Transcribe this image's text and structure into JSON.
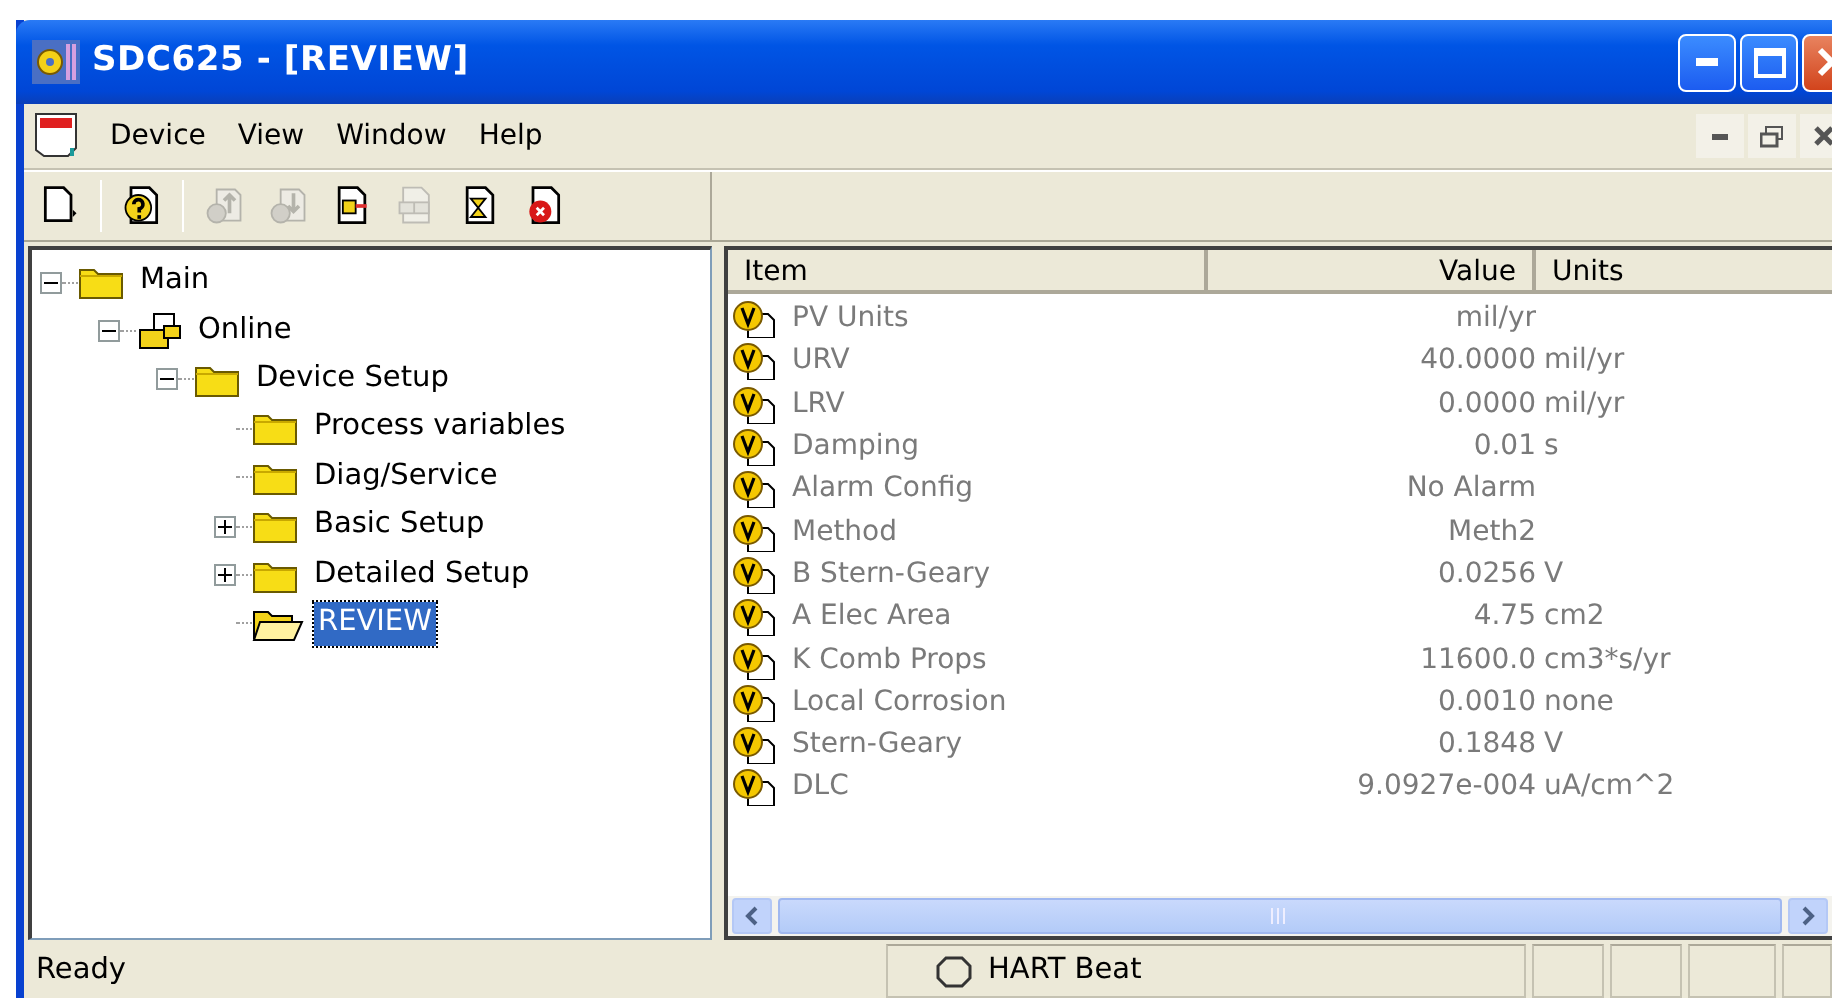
{
  "window": {
    "title": "SDC625 - [REVIEW]"
  },
  "menu": [
    "Device",
    "View",
    "Window",
    "Help"
  ],
  "toolbar": [
    {
      "kind": "new",
      "disabled": false
    },
    {
      "kind": "help",
      "disabled": false
    },
    {
      "kind": "upload",
      "disabled": true
    },
    {
      "kind": "download",
      "disabled": true
    },
    {
      "kind": "export",
      "disabled": false
    },
    {
      "kind": "grid",
      "disabled": true
    },
    {
      "kind": "wait",
      "disabled": false
    },
    {
      "kind": "stop",
      "disabled": false
    }
  ],
  "tree": [
    {
      "label": "Main",
      "kind": "folder",
      "expanded": true,
      "selected": false,
      "children": [
        {
          "label": "Online",
          "kind": "network",
          "expanded": true,
          "selected": false,
          "children": [
            {
              "label": "Device Setup",
              "kind": "folder",
              "expanded": true,
              "selected": false,
              "children": [
                {
                  "label": "Process variables",
                  "kind": "folder",
                  "selected": false
                },
                {
                  "label": "Diag/Service",
                  "kind": "folder",
                  "selected": false
                },
                {
                  "label": "Basic Setup",
                  "kind": "folder",
                  "expanded": false,
                  "selected": false
                },
                {
                  "label": "Detailed Setup",
                  "kind": "folder",
                  "expanded": false,
                  "selected": false
                },
                {
                  "label": "REVIEW",
                  "kind": "folder",
                  "selected": true
                }
              ]
            }
          ]
        }
      ]
    }
  ],
  "table": {
    "columns": [
      "Item",
      "Value",
      "Units"
    ],
    "rows": [
      {
        "item": "PV Units",
        "value": "mil/yr"
      },
      {
        "item": "URV",
        "value": "40.0000",
        "units": "mil/yr"
      },
      {
        "item": "LRV",
        "value": "0.0000",
        "units": "mil/yr"
      },
      {
        "item": "Damping",
        "value": "0.01",
        "units": "s"
      },
      {
        "item": "Alarm Config",
        "value": "No Alarm"
      },
      {
        "item": "Method",
        "value": "Meth2"
      },
      {
        "item": "B Stern-Geary",
        "value": "0.0256",
        "units": "V"
      },
      {
        "item": "A Elec Area",
        "value": "4.75",
        "units": "cm2"
      },
      {
        "item": "K Comb Props",
        "value": "11600.0",
        "units": "cm3*s/yr"
      },
      {
        "item": "Local Corrosion",
        "value": "0.0010",
        "units": "none"
      },
      {
        "item": "Stern-Geary",
        "value": "0.1848",
        "units": "V"
      },
      {
        "item": "DLC",
        "value": "9.0927e-004",
        "units": "uA/cm^2"
      }
    ]
  },
  "status_bar": {
    "message": "Ready",
    "heartbeat": "HART Beat"
  }
}
